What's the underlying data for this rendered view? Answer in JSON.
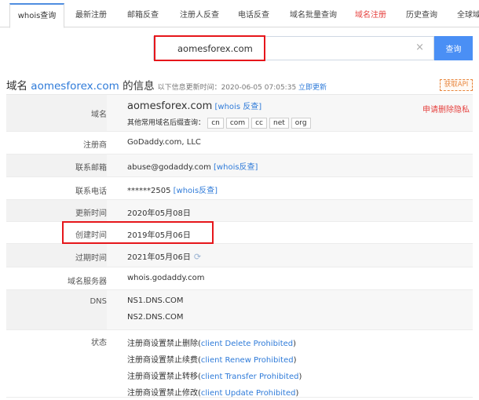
{
  "tabs": [
    {
      "label": "whois查询",
      "active": true
    },
    {
      "label": "最新注册"
    },
    {
      "label": "邮箱反查"
    },
    {
      "label": "注册人反查"
    },
    {
      "label": "电话反查"
    },
    {
      "label": "域名批量查询"
    },
    {
      "label": "域名注册",
      "color": "#e64340"
    },
    {
      "label": "历史查询"
    },
    {
      "label": "全球域"
    }
  ],
  "search": {
    "value": "aomesforex.com",
    "clear_icon": "×",
    "button": "查询"
  },
  "heading": {
    "prefix": "域名 ",
    "domain": "aomesforex.com",
    "suffix": " 的信息",
    "updated_text": "以下信息更新时间：2020-06-05 07:05:35",
    "update_now": "立即更新",
    "api_button": "获取API"
  },
  "rows": {
    "domain": {
      "label": "域名",
      "value": "aomesforex.com",
      "whois_link": "[whois 反查]",
      "privacy_link": "申请删除隐私",
      "suffix_label": "其他常用域名后缀查询：",
      "suffixes": [
        "cn",
        "com",
        "cc",
        "net",
        "org"
      ]
    },
    "registrar": {
      "label": "注册商",
      "value": "GoDaddy.com, LLC"
    },
    "email": {
      "label": "联系邮箱",
      "value": "abuse@godaddy.com",
      "link": "[whois反查]"
    },
    "phone": {
      "label": "联系电话",
      "value": "******2505",
      "link": "[whois反查]"
    },
    "updated": {
      "label": "更新时间",
      "value": "2020年05月08日"
    },
    "created": {
      "label": "创建时间",
      "value": "2019年05月06日"
    },
    "expires": {
      "label": "过期时间",
      "value": "2021年05月06日",
      "icon": "refresh-icon"
    },
    "nameserver": {
      "label": "域名服务器",
      "value": "whois.godaddy.com"
    },
    "dns": {
      "label": "DNS",
      "values": [
        "NS1.DNS.COM",
        "NS2.DNS.COM"
      ]
    },
    "status": {
      "label": "状态",
      "items": [
        {
          "prefix": "注册商设置禁止删除(",
          "code": "client Delete Prohibited",
          "suffix": ")"
        },
        {
          "prefix": "注册商设置禁止续费(",
          "code": "client Renew Prohibited",
          "suffix": ")"
        },
        {
          "prefix": "注册商设置禁止转移(",
          "code": "client Transfer Prohibited",
          "suffix": ")"
        },
        {
          "prefix": "注册商设置禁止修改(",
          "code": "client Update Prohibited",
          "suffix": ")"
        }
      ]
    }
  },
  "colors": {
    "accent": "#2f7bd9",
    "search_button": "#4a8ff5",
    "highlight": "#e6161b",
    "danger_text": "#e64340",
    "api_border": "#e8863d"
  }
}
